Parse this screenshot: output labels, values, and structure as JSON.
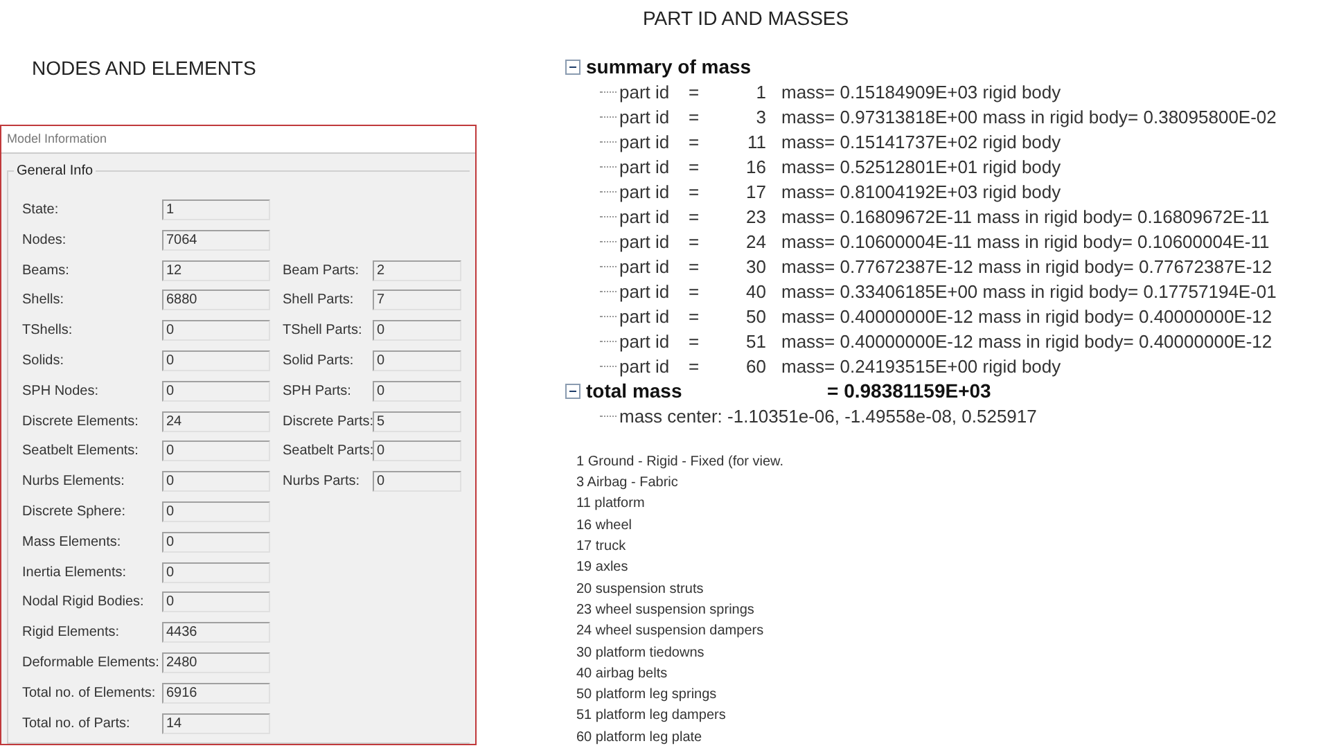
{
  "slide_titles": [
    {
      "text": "NODES AND ELEMENTS"
    },
    {
      "text": "PART ID AND MASSES"
    }
  ],
  "model_information": {
    "title": "Model Information",
    "group_title": "General Info",
    "rows": [
      {
        "label": "State:",
        "value": "1"
      },
      {
        "label": "Nodes:",
        "value": "7064"
      },
      {
        "label": "Beams:",
        "value": "12",
        "part_label": "Beam Parts:",
        "part_value": "2"
      },
      {
        "label": "Shells:",
        "value": "6880",
        "part_label": "Shell Parts:",
        "part_value": "7"
      },
      {
        "label": "TShells:",
        "value": "0",
        "part_label": "TShell Parts:",
        "part_value": "0"
      },
      {
        "label": "Solids:",
        "value": "0",
        "part_label": "Solid Parts:",
        "part_value": "0"
      },
      {
        "label": "SPH Nodes:",
        "value": "0",
        "part_label": "SPH Parts:",
        "part_value": "0"
      },
      {
        "label": "Discrete Elements:",
        "value": "24",
        "part_label": "Discrete Parts:",
        "part_value": "5"
      },
      {
        "label": "Seatbelt Elements:",
        "value": "0",
        "part_label": "Seatbelt Parts:",
        "part_value": "0"
      },
      {
        "label": "Nurbs Elements:",
        "value": "0",
        "part_label": "Nurbs Parts:",
        "part_value": "0"
      },
      {
        "label": "Discrete Sphere:",
        "value": "0"
      },
      {
        "label": "Mass Elements:",
        "value": "0"
      },
      {
        "label": "Inertia Elements:",
        "value": "0"
      },
      {
        "label": "Nodal Rigid Bodies:",
        "value": "0"
      },
      {
        "label": "Rigid Elements:",
        "value": "4436"
      },
      {
        "label": "Deformable Elements:",
        "value": "2480"
      },
      {
        "label": "Total no. of Elements:",
        "value": "6916"
      },
      {
        "label": "Total no. of Parts:",
        "value": "14"
      }
    ]
  },
  "mass_tree": [
    {
      "label": "summary of mass",
      "expanded": true,
      "children": [
        {
          "label": "part id",
          "equals": "=",
          "id": "1",
          "mass": "mass= 0.15184909E+03 rigid body"
        },
        {
          "label": "part id",
          "equals": "=",
          "id": "3",
          "mass": "mass= 0.97313818E+00 mass in rigid body= 0.38095800E-02"
        },
        {
          "label": "part id",
          "equals": "=",
          "id": "11",
          "mass": "mass= 0.15141737E+02 rigid body"
        },
        {
          "label": "part id",
          "equals": "=",
          "id": "16",
          "mass": "mass= 0.52512801E+01 rigid body"
        },
        {
          "label": "part id",
          "equals": "=",
          "id": "17",
          "mass": "mass= 0.81004192E+03 rigid body"
        },
        {
          "label": "part id",
          "equals": "=",
          "id": "23",
          "mass": "mass= 0.16809672E-11 mass in rigid body= 0.16809672E-11"
        },
        {
          "label": "part id",
          "equals": "=",
          "id": "24",
          "mass": "mass= 0.10600004E-11 mass in rigid body= 0.10600004E-11"
        },
        {
          "label": "part id",
          "equals": "=",
          "id": "30",
          "mass": "mass= 0.77672387E-12 mass in rigid body= 0.77672387E-12"
        },
        {
          "label": "part id",
          "equals": "=",
          "id": "40",
          "mass": "mass= 0.33406185E+00 mass in rigid body= 0.17757194E-01"
        },
        {
          "label": "part id",
          "equals": "=",
          "id": "50",
          "mass": "mass= 0.40000000E-12 mass in rigid body= 0.40000000E-12"
        },
        {
          "label": "part id",
          "equals": "=",
          "id": "51",
          "mass": "mass= 0.40000000E-12 mass in rigid body= 0.40000000E-12"
        },
        {
          "label": "part id",
          "equals": "=",
          "id": "60",
          "mass": "mass= 0.24193515E+00 rigid body"
        }
      ]
    },
    {
      "label": "total mass",
      "value": "= 0.98381159E+03",
      "expanded": true,
      "children": [
        {
          "label": "mass center: -1.10351e-06, -1.49558e-08, 0.525917"
        }
      ]
    }
  ],
  "part_names": [
    "1 Ground - Rigid - Fixed (for view.",
    "3 Airbag - Fabric",
    "11 platform",
    "16 wheel",
    "17 truck",
    "19 axles",
    "20 suspension struts",
    "23 wheel suspension springs",
    "24 wheel suspension dampers",
    "30 platform tiedowns",
    "40 airbag belts",
    "50 platform leg springs",
    "51 platform leg dampers",
    "60 platform leg plate"
  ]
}
